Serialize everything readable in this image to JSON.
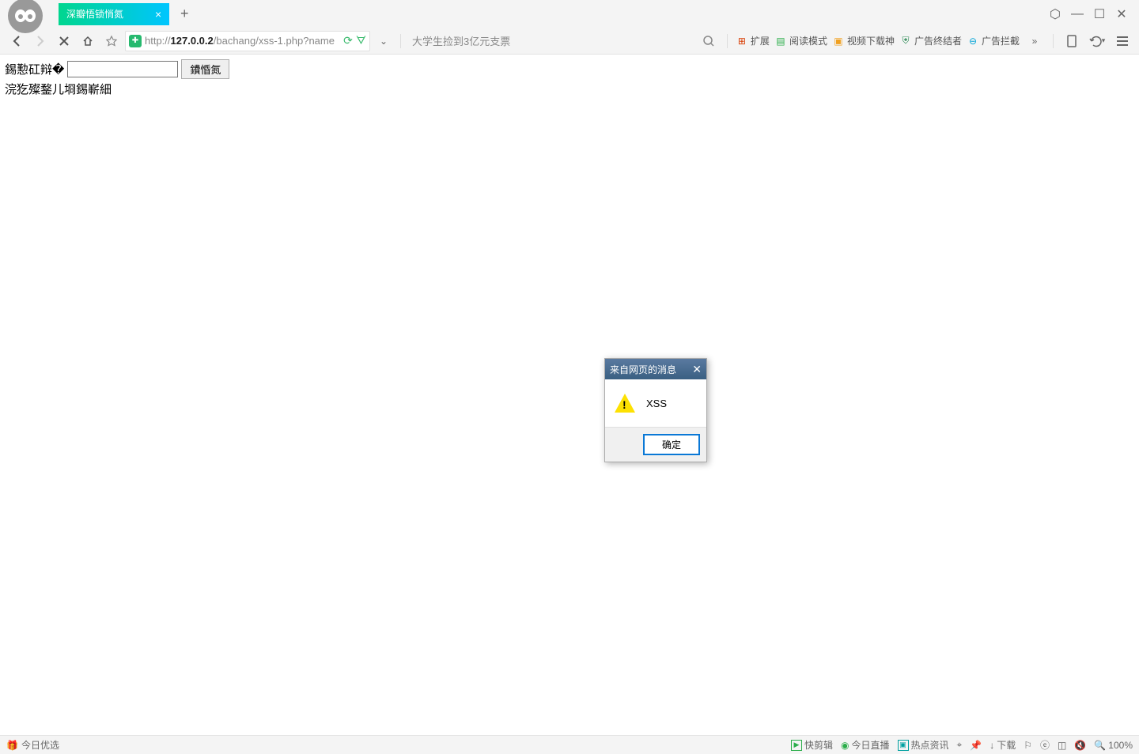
{
  "tab": {
    "title": "深瓣悟锁悄氮",
    "close": "×"
  },
  "window": {
    "fix": "⬡",
    "min": "—",
    "max": "☐",
    "close": "✕"
  },
  "toolbar": {
    "url_prefix": "http://",
    "url_host": "127.0.0.2",
    "url_path": "/bachang/xss-1.php?name",
    "dropdown": "⌄",
    "hint": "大学生捡到3亿元支票",
    "ext1": "扩展",
    "ext2": "阅读模式",
    "ext3": "视频下载神",
    "ext4": "广告终结者",
    "ext5": "广告拦截",
    "more": "»"
  },
  "page": {
    "label": "錫懃矼辩�",
    "input_value": "",
    "button": "鐨惛氮",
    "line2": "浣犵殩鍪儿埛錫嶄細"
  },
  "dialog": {
    "title": "来自网页的消息",
    "message": "XSS",
    "ok": "确定"
  },
  "status": {
    "left": "今日优选",
    "i1": "快剪辑",
    "i2": "今日直播",
    "i3": "热点资讯",
    "dl": "下载",
    "zoom": "100%"
  }
}
